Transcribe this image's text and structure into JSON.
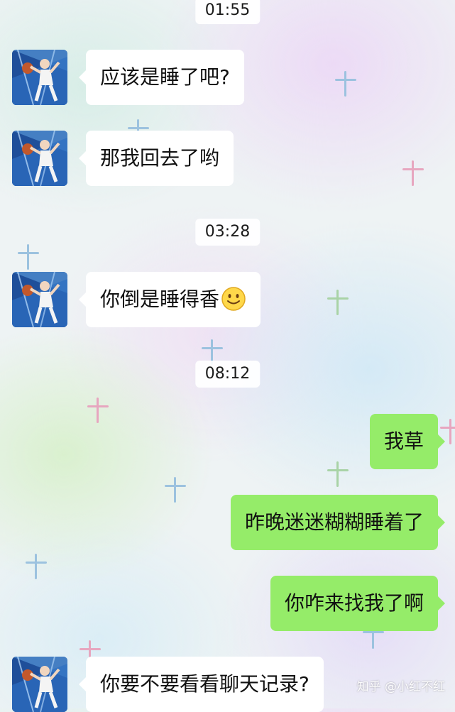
{
  "chat": {
    "timestamps": [
      "01:55",
      "03:28",
      "08:12"
    ],
    "messages": [
      {
        "sender": "other",
        "text": "应该是睡了吧?"
      },
      {
        "sender": "other",
        "text": "那我回去了哟"
      },
      {
        "sender": "other",
        "text": "你倒是睡得香",
        "emoji": "smile-emoji"
      },
      {
        "sender": "self",
        "text": "我草"
      },
      {
        "sender": "self",
        "text": "昨晚迷迷糊糊睡着了"
      },
      {
        "sender": "self",
        "text": "你咋来找我了啊"
      },
      {
        "sender": "other",
        "text": "你要不要看看聊天记录?"
      }
    ]
  },
  "watermark": "知乎 @小红不红",
  "colors": {
    "incoming_bubble": "#ffffff",
    "outgoing_bubble": "#95ec69",
    "text": "#111111"
  }
}
